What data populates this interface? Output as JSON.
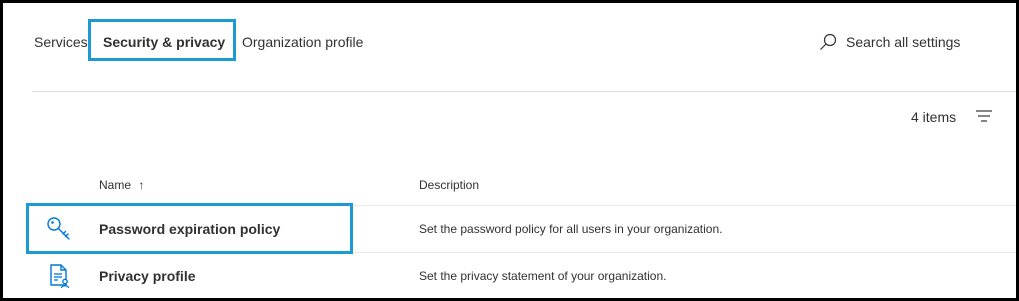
{
  "tabs": [
    {
      "label": "Services"
    },
    {
      "label": "Security & privacy"
    },
    {
      "label": "Organization profile"
    }
  ],
  "search": {
    "label": "Search all settings",
    "icon": "search-icon"
  },
  "list": {
    "count": "4 items",
    "columns": {
      "name": "Name",
      "sort_indicator": "↑",
      "description": "Description"
    },
    "rows": [
      {
        "icon": "key-icon",
        "name": "Password expiration policy",
        "description": "Set the password policy for all users in your organization."
      },
      {
        "icon": "privacy-document-icon",
        "name": "Privacy profile",
        "description": "Set the privacy statement of your organization."
      }
    ]
  },
  "colors": {
    "highlight": "#1c9ad6",
    "icon_blue": "#0078d4",
    "text": "#323130"
  }
}
